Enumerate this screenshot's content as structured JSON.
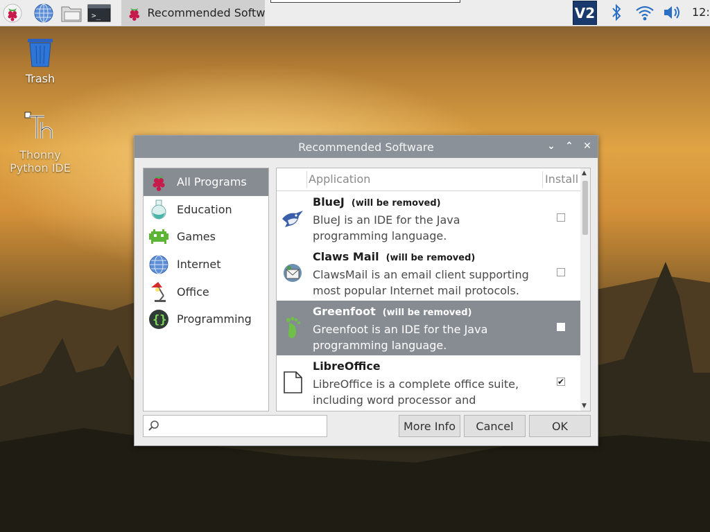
{
  "taskbar": {
    "window_title": "Recommended Softw…",
    "clock": "12:",
    "tray_vnc_label": "V2"
  },
  "desktop": {
    "icons": [
      {
        "label": "Trash",
        "icon": "trash-icon"
      },
      {
        "label_line1": "Thonny",
        "label_line2": "Python IDE",
        "icon": "thonny-icon"
      }
    ]
  },
  "dialog": {
    "title": "Recommended Software",
    "categories": [
      {
        "label": "All Programs",
        "icon": "raspberry-icon",
        "selected": true
      },
      {
        "label": "Education",
        "icon": "flask-icon"
      },
      {
        "label": "Games",
        "icon": "alien-icon"
      },
      {
        "label": "Internet",
        "icon": "globe-icon"
      },
      {
        "label": "Office",
        "icon": "desk-lamp-icon"
      },
      {
        "label": "Programming",
        "icon": "braces-icon"
      }
    ],
    "columns": {
      "application": "Application",
      "install": "Install"
    },
    "apps": [
      {
        "name": "BlueJ",
        "note": "(will be removed)",
        "desc": "BlueJ is an IDE for the Java programming language.",
        "icon": "bluej-bird-icon",
        "checked": false,
        "selected": false
      },
      {
        "name": "Claws Mail",
        "note": "(will be removed)",
        "desc": "ClawsMail is an email client supporting most popular Internet mail protocols.",
        "icon": "claws-mail-icon",
        "checked": false,
        "selected": false
      },
      {
        "name": "Greenfoot",
        "note": "(will be removed)",
        "desc": "Greenfoot is an IDE for the Java programming language.",
        "icon": "greenfoot-icon",
        "checked": false,
        "selected": true
      },
      {
        "name": "LibreOffice",
        "note": "",
        "desc": "LibreOffice is a complete office suite, including word processor and spreadsheet.",
        "icon": "document-icon",
        "checked": true,
        "selected": false
      }
    ],
    "search": {
      "placeholder": "",
      "value": ""
    },
    "buttons": {
      "more_info": "More Info",
      "cancel": "Cancel",
      "ok": "OK"
    },
    "checkmark": "✔"
  }
}
